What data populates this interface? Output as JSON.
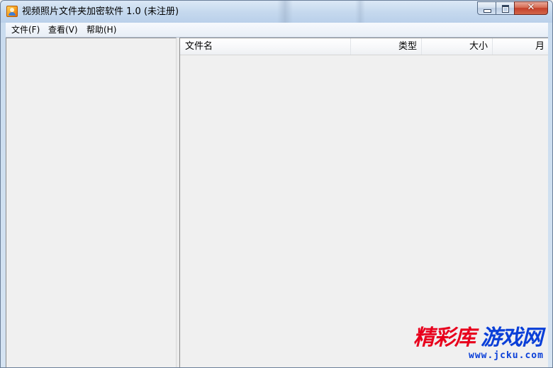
{
  "window": {
    "title": "视频照片文件夹加密软件 1.0 (未注册)",
    "icon": "app-photo-lock-icon",
    "controls": {
      "minimize": "minimize-icon",
      "maximize": "maximize-icon",
      "close_glyph": "✕"
    }
  },
  "menu": {
    "items": [
      {
        "label": "文件(F)"
      },
      {
        "label": "查看(V)"
      },
      {
        "label": "帮助(H)"
      }
    ]
  },
  "file_list": {
    "columns": [
      {
        "label": "文件名"
      },
      {
        "label": "类型"
      },
      {
        "label": "大小"
      },
      {
        "label": "月"
      }
    ],
    "rows": []
  },
  "watermark": {
    "text_red": "精彩库",
    "text_blue": "游戏网",
    "url": "www.jcku.com",
    "colors": {
      "red": "#e8001c",
      "blue": "#0a3fd8"
    }
  }
}
